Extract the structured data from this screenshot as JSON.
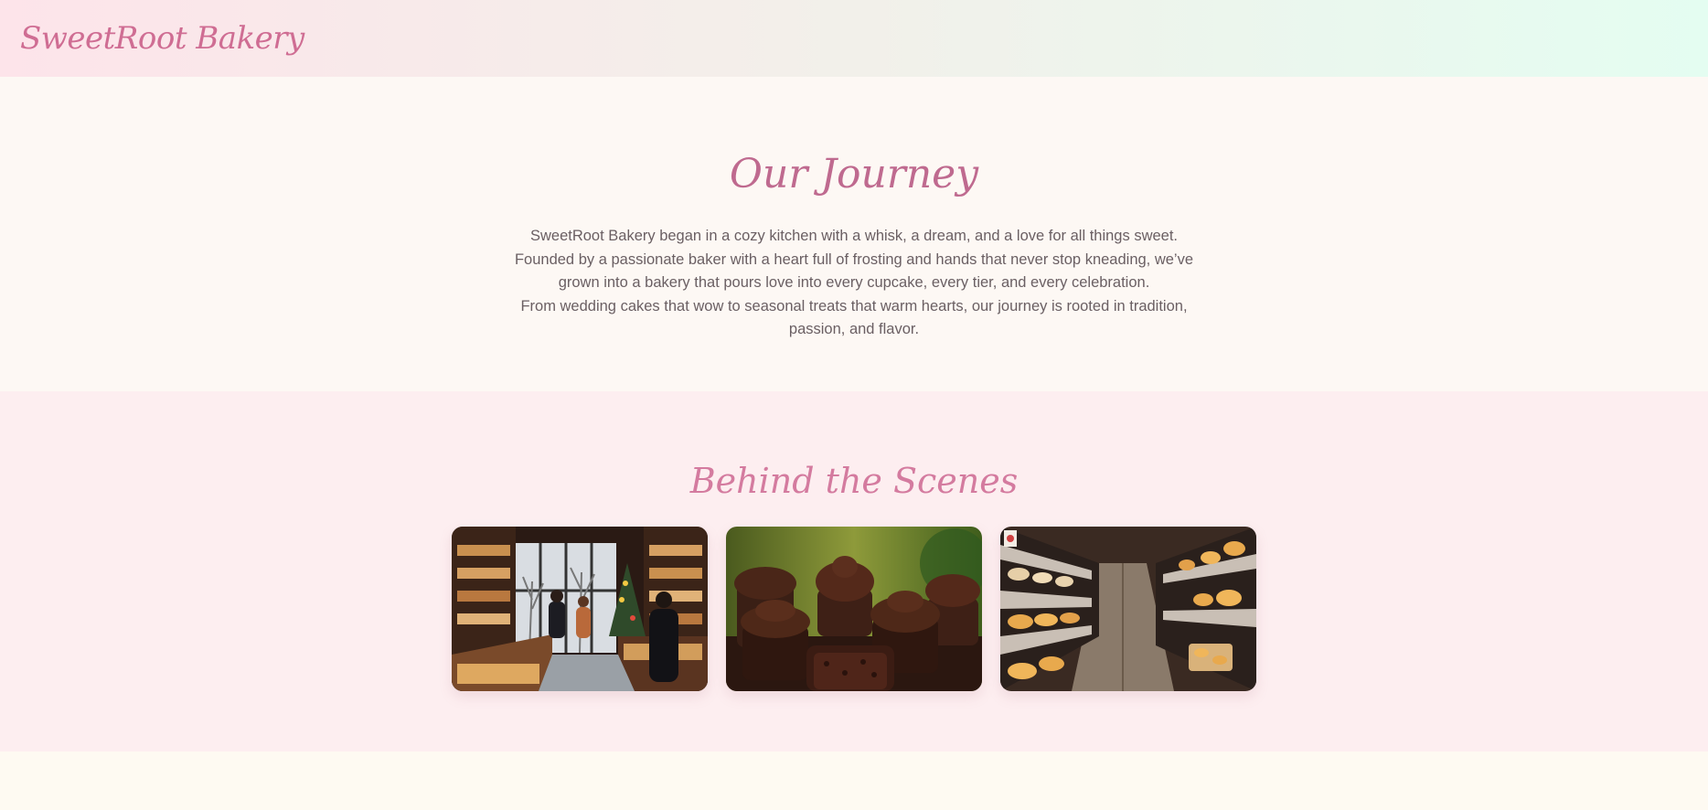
{
  "header": {
    "brand": "SweetRoot Bakery"
  },
  "journey": {
    "title": "Our Journey",
    "paragraphs": {
      "p1": "SweetRoot Bakery began in a cozy kitchen with a whisk, a dream, and a love for all things sweet. Founded by a passionate baker with a heart full of frosting and hands that never stop kneading, we’ve grown into a bakery that pours love into every cupcake, every tier, and every celebration.",
      "p2": "From wedding cakes that wow to seasonal treats that warm hearts, our journey is rooted in tradition, passion, and flavor."
    }
  },
  "scenes": {
    "title": "Behind the Scenes",
    "photos": [
      {
        "subject": "bakery-storefront-interior"
      },
      {
        "subject": "chocolate-cupcakes"
      },
      {
        "subject": "pastry-display-shelves"
      }
    ]
  },
  "colors": {
    "brand_pink": "#cf6d93",
    "heading_rose": "#bf6a8f",
    "body_text": "#6a5f63",
    "scenes_bg": "#fdeef0"
  }
}
